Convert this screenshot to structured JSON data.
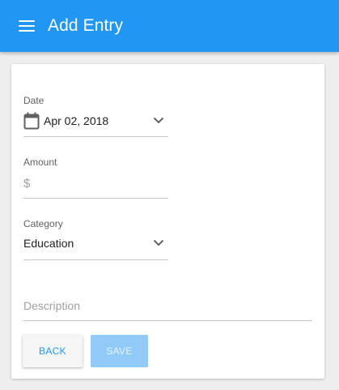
{
  "appbar": {
    "title": "Add Entry",
    "color": "#2196f3"
  },
  "form": {
    "date": {
      "label": "Date",
      "value": "Apr 02, 2018",
      "icon": "calendar-icon"
    },
    "amount": {
      "label": "Amount",
      "prefix": "$",
      "value": ""
    },
    "category": {
      "label": "Category",
      "value": "Education"
    },
    "description": {
      "placeholder": "Description",
      "value": ""
    }
  },
  "actions": {
    "back_label": "BACK",
    "save_label": "SAVE"
  }
}
